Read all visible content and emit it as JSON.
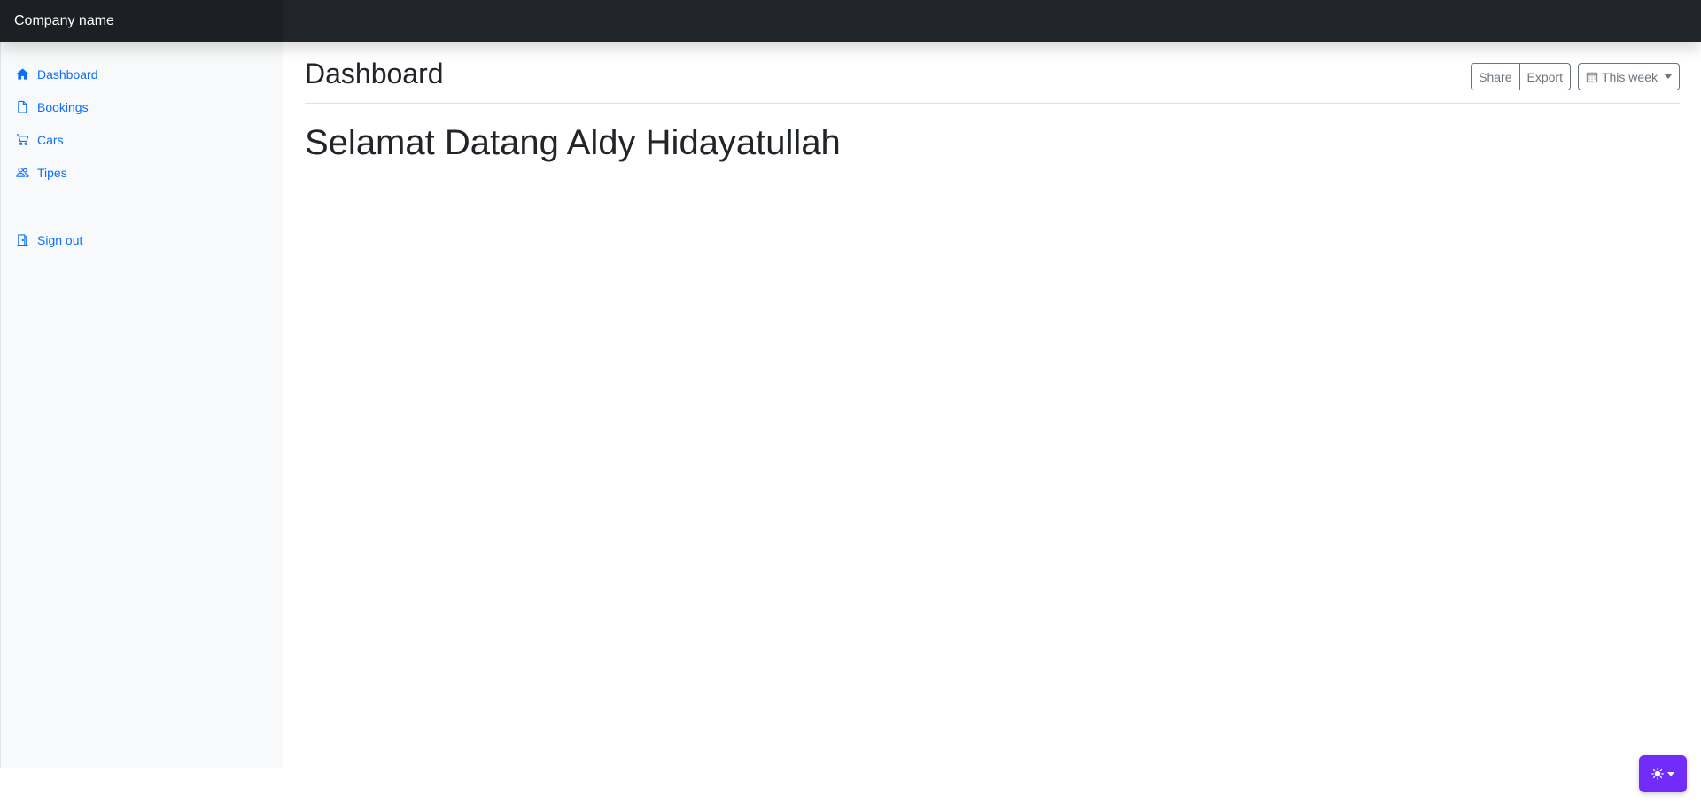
{
  "navbar": {
    "brand": "Company name"
  },
  "sidebar": {
    "items": [
      {
        "label": "Dashboard",
        "icon": "house-icon"
      },
      {
        "label": "Bookings",
        "icon": "file-icon"
      },
      {
        "label": "Cars",
        "icon": "cart-icon"
      },
      {
        "label": "Tipes",
        "icon": "people-icon"
      }
    ],
    "signout": {
      "label": "Sign out",
      "icon": "door-icon"
    }
  },
  "main": {
    "title": "Dashboard",
    "toolbar": {
      "share_label": "Share",
      "export_label": "Export",
      "period_label": "This week"
    },
    "welcome": "Selamat Datang Aldy Hidayatullah"
  },
  "theme_toggle": {
    "icon": "sun-icon"
  },
  "colors": {
    "navbar": "#212529",
    "brand_bg": "#1c1f23",
    "link": "#0d6efd",
    "sidebar_bg": "#f8f9fa",
    "toggle": "#712cf9"
  }
}
